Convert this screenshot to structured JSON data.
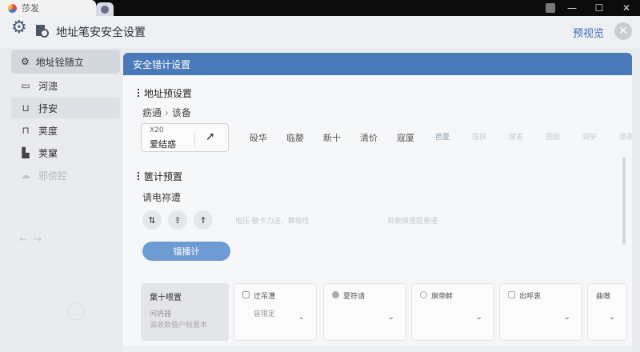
{
  "os": {
    "tab_title": "莎发",
    "controls": {
      "minimize": "—",
      "maximize": "☐",
      "close": "✕"
    }
  },
  "header": {
    "title": "地址笔安安全设置",
    "preview_label": "预视览",
    "close_label": "✕"
  },
  "sidebar": {
    "head_label": "地址铨随立",
    "items": [
      {
        "label": "河漶",
        "icon": "monitor-icon"
      },
      {
        "label": "抒安",
        "icon": "laptop-icon"
      },
      {
        "label": "荚度",
        "icon": "lock-icon"
      },
      {
        "label": "荚窠",
        "icon": "building-icon"
      },
      {
        "label": "邪傍腔",
        "icon": "cloud-icon"
      }
    ]
  },
  "panel": {
    "header_title": "安全错计设置",
    "address_section": {
      "title": "地址预设置",
      "breadcrumb": [
        "疬通",
        "该备"
      ],
      "box_small": "X20",
      "box_value": "爱结惑",
      "chips": [
        "砓华",
        "临嫠",
        "新十",
        "清价",
        "寇厦",
        "芭夏",
        "强挟",
        "嫁害",
        "囿困",
        "袋驴",
        "添茶"
      ]
    },
    "calc_section": {
      "title": "篋计预置",
      "subtitle": "请电祢遭",
      "buttons": [
        "⇅",
        "⇪",
        "⇑"
      ],
      "blur_1": "电压·敏卡力送，算级性",
      "blur_2": "规数搜速提重速 ·",
      "action_label": "镭播计"
    },
    "options": [
      {
        "title": "葉十喂置",
        "line2": "问坍器",
        "line3": "调收数值户帖置本"
      },
      {
        "title": "迂吊漕",
        "line2": "容限定"
      },
      {
        "title": "夏符请"
      },
      {
        "title": "旗帝衅"
      },
      {
        "title": "出呼衷"
      },
      {
        "title": "曲嗷"
      }
    ]
  }
}
